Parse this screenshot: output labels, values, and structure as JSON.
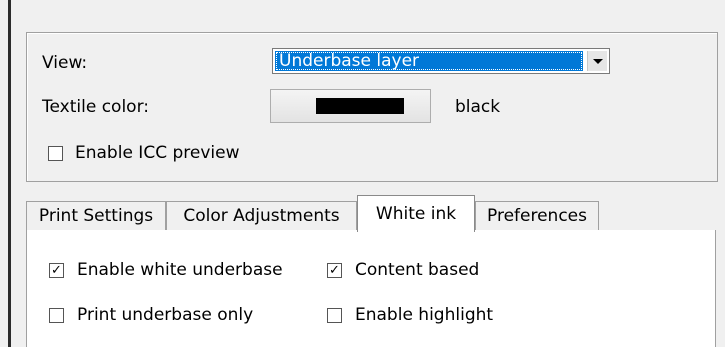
{
  "view": {
    "label": "View:",
    "selected": "Underbase layer"
  },
  "textile_color": {
    "label": "Textile color:",
    "value": "black",
    "swatch_color": "#000000"
  },
  "icc_preview": {
    "label": "Enable ICC preview",
    "checked": false
  },
  "tabs": [
    {
      "label": "Print Settings",
      "active": false
    },
    {
      "label": "Color Adjustments",
      "active": false
    },
    {
      "label": "White ink",
      "active": true
    },
    {
      "label": "Preferences",
      "active": false
    }
  ],
  "white_ink": {
    "enable_white_underbase": {
      "label": "Enable white underbase",
      "checked": true
    },
    "content_based": {
      "label": "Content based",
      "checked": true
    },
    "print_underbase_only": {
      "label": "Print underbase only",
      "checked": false
    },
    "enable_highlight": {
      "label": "Enable highlight",
      "checked": false
    }
  },
  "colors": {
    "selection_highlight": "#0078d7",
    "window_background": "#f0f0f0",
    "tab_panel_background": "#ffffff"
  }
}
